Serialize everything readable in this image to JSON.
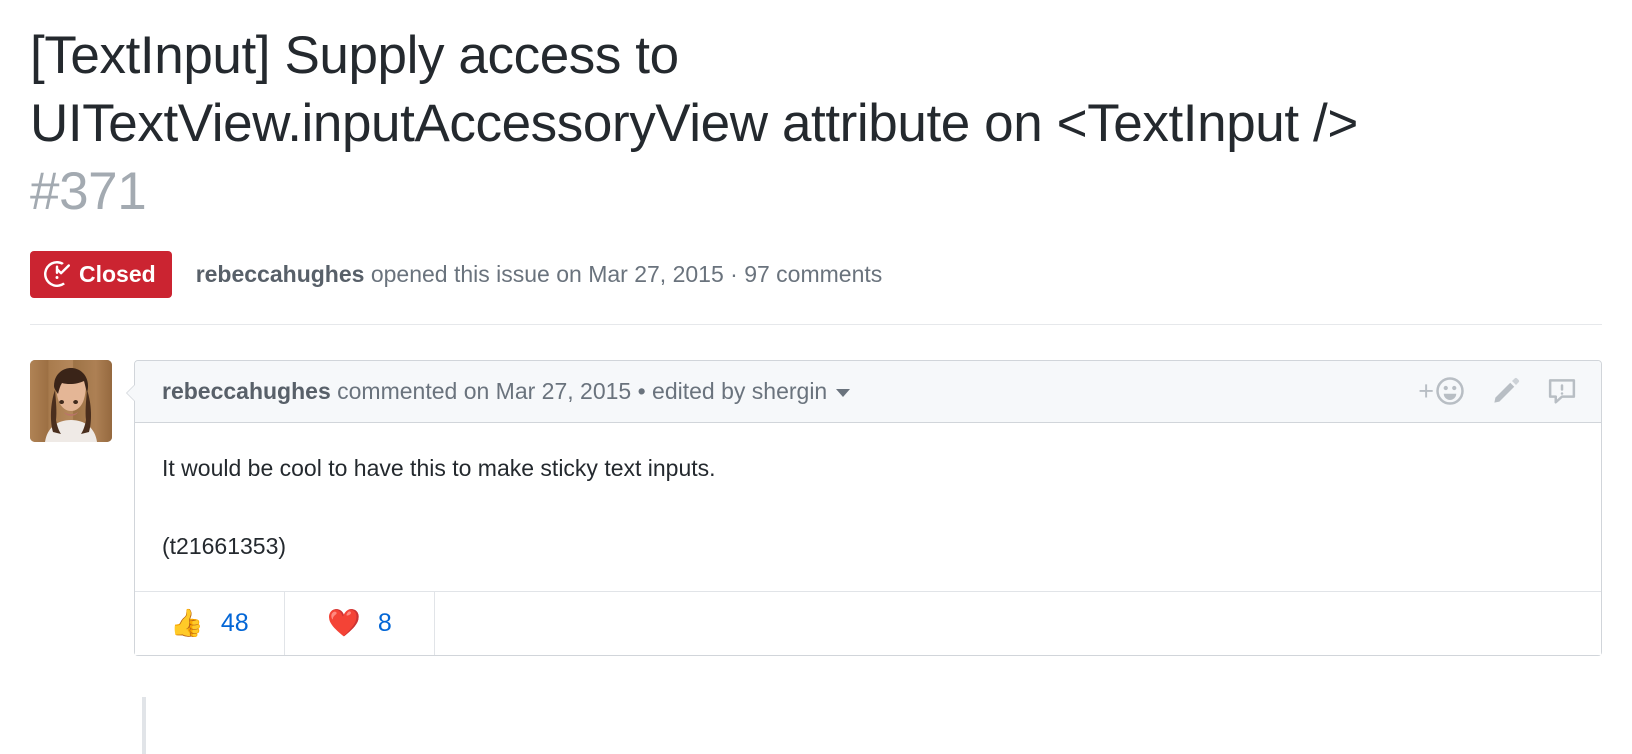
{
  "issue": {
    "title": "[TextInput] Supply access to UITextView.inputAccessoryView attribute on <TextInput />",
    "title_line1": "[TextInput] Supply access to",
    "title_line2": "UITextView.inputAccessoryView attribute on <TextInput />",
    "number": "#371",
    "state_label": "Closed",
    "state_color": "#cb2431",
    "meta_author": "rebeccahughes",
    "meta_action": "opened this issue on",
    "meta_date": "Mar 27, 2015",
    "meta_separator": "·",
    "meta_comments": "97 comments"
  },
  "comment": {
    "author": "rebeccahughes",
    "action": "commented on",
    "date": "Mar 27, 2015",
    "edit_separator": "•",
    "edited_by": "edited by shergin",
    "body_paragraph_1": "It would be cool to have this to make sticky text inputs.",
    "body_paragraph_2": "(t21661353)",
    "actions": {
      "add_reaction_plus": "+",
      "add_reaction_name": "add-reaction",
      "edit_name": "edit-comment",
      "report_name": "report-content"
    },
    "reactions": [
      {
        "emoji": "👍",
        "name": "thumbs-up",
        "count": "48"
      },
      {
        "emoji": "❤️",
        "name": "heart",
        "count": "8"
      }
    ]
  },
  "colors": {
    "link": "#0366d6",
    "muted": "#6a737d",
    "border": "#d1d5da",
    "header_bg": "#f6f8fa"
  }
}
